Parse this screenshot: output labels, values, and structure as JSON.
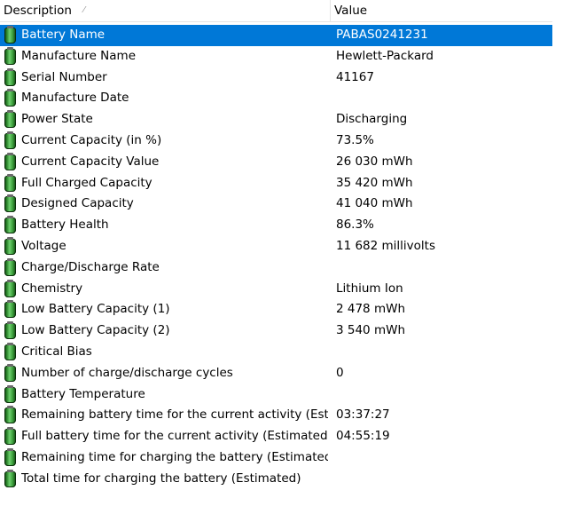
{
  "header": {
    "description": "Description",
    "value": "Value"
  },
  "rows": [
    {
      "label": "Battery Name",
      "value": "PABAS0241231"
    },
    {
      "label": "Manufacture Name",
      "value": "Hewlett-Packard"
    },
    {
      "label": "Serial Number",
      "value": "41167"
    },
    {
      "label": "Manufacture Date",
      "value": ""
    },
    {
      "label": "Power State",
      "value": "Discharging"
    },
    {
      "label": "Current Capacity (in %)",
      "value": "73.5%"
    },
    {
      "label": "Current Capacity Value",
      "value": "26 030 mWh"
    },
    {
      "label": "Full Charged Capacity",
      "value": "35 420 mWh"
    },
    {
      "label": "Designed Capacity",
      "value": "41 040 mWh"
    },
    {
      "label": "Battery Health",
      "value": "86.3%"
    },
    {
      "label": "Voltage",
      "value": "11 682 millivolts"
    },
    {
      "label": "Charge/Discharge Rate",
      "value": ""
    },
    {
      "label": "Chemistry",
      "value": "Lithium Ion"
    },
    {
      "label": "Low Battery Capacity (1)",
      "value": "2 478 mWh"
    },
    {
      "label": "Low Battery Capacity (2)",
      "value": "3 540 mWh"
    },
    {
      "label": "Critical Bias",
      "value": ""
    },
    {
      "label": "Number of charge/discharge cycles",
      "value": "0"
    },
    {
      "label": "Battery Temperature",
      "value": ""
    },
    {
      "label": "Remaining battery time for the current activity (Est...",
      "value": "03:37:27"
    },
    {
      "label": "Full battery time for the current activity (Estimated)",
      "value": "04:55:19"
    },
    {
      "label": "Remaining time for charging the battery (Estimated)",
      "value": ""
    },
    {
      "label": "Total  time for charging the battery (Estimated)",
      "value": ""
    }
  ],
  "row_icon": "battery-icon",
  "colors": {
    "selection": "#0078d7",
    "selection_text": "#ffffff",
    "battery_icon": "#3ea33e"
  }
}
